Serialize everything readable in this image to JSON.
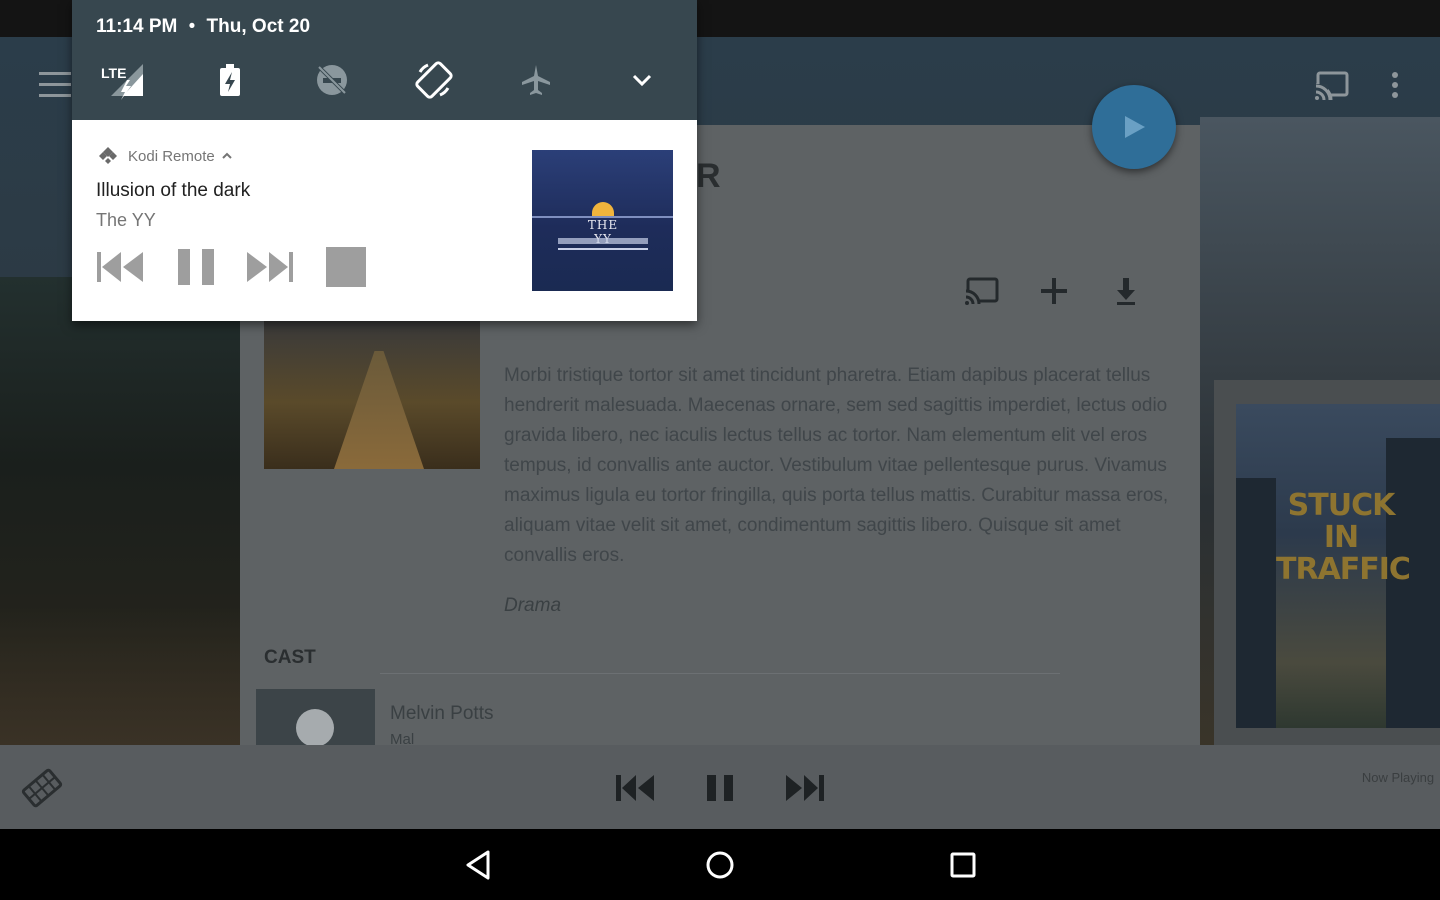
{
  "status_bar": {
    "time": "11:14 PM",
    "separator": "•",
    "date": "Thu, Oct 20",
    "network": "LTE"
  },
  "notification": {
    "app_name": "Kodi Remote",
    "track_title": "Illusion of the dark",
    "artist": "The YY",
    "album_art_text": "THE YY"
  },
  "details": {
    "title_fragment": "R",
    "description": "Morbi tristique tortor sit amet tincidunt pharetra. Etiam dapibus placerat tellus hendrerit malesuada. Maecenas ornare, sem sed sagittis imperdiet, lectus odio gravida libero, nec iaculis lectus tellus ac tortor. Nam elementum elit vel eros tempus, id convallis ante auctor. Vestibulum vitae pellentesque purus. Vivamus maximus ligula eu tortor fringilla, quis porta tellus mattis. Curabitur massa eros, aliquam vitae velit sit amet, condimentum sagittis libero. Quisque sit amet convallis eros.",
    "genre": "Drama",
    "cast_heading": "CAST",
    "cast": [
      {
        "name": "Melvin Potts",
        "role": "Mal"
      }
    ]
  },
  "next_item": {
    "poster_title": "STUCK IN TRAFFIC"
  },
  "bottom_bar": {
    "now_playing": "Now Playing"
  },
  "colors": {
    "fab": "#2f6e98",
    "shade": "#37474f",
    "notification_bg": "#ffffff",
    "bottom_bar": "#585c5f"
  },
  "icons": {
    "menu": "hamburger-icon",
    "cast": "cast-icon",
    "more": "more-vert-icon",
    "play": "play-icon",
    "add": "plus-icon",
    "download": "download-icon",
    "lte": "lte-signal-icon",
    "battery": "battery-charging-icon",
    "dnd": "do-not-disturb-icon",
    "rotate": "auto-rotate-icon",
    "airplane": "airplane-mode-icon",
    "expand": "chevron-down-icon"
  }
}
